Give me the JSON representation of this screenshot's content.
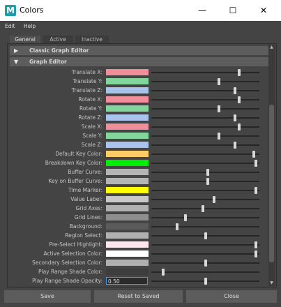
{
  "window": {
    "title": "Colors",
    "app_icon_letter": "M",
    "minimize": "—",
    "maximize": "☐",
    "close": "✕"
  },
  "menu": [
    "Edit",
    "Help"
  ],
  "tabs": [
    "General",
    "Active",
    "Inactive"
  ],
  "sections": {
    "classic": "Classic Graph Editor",
    "graph": "Graph Editor",
    "classic_icon": "collapsed-triangle-icon",
    "graph_icon": "expanded-triangle-icon"
  },
  "rows": [
    {
      "label": "Translate X:",
      "color": "#f08e9b",
      "level": 0.82
    },
    {
      "label": "Translate Y:",
      "color": "#82d69c",
      "level": 0.63
    },
    {
      "label": "Translate Z:",
      "color": "#a9c4ec",
      "level": 0.78
    },
    {
      "label": "Rotate X:",
      "color": "#f08e9b",
      "level": 0.82
    },
    {
      "label": "Rotate Y:",
      "color": "#82d69c",
      "level": 0.63
    },
    {
      "label": "Rotate Z:",
      "color": "#a9c4ec",
      "level": 0.78
    },
    {
      "label": "Scale X:",
      "color": "#f08e9b",
      "level": 0.82
    },
    {
      "label": "Scale Y:",
      "color": "#82d69c",
      "level": 0.63
    },
    {
      "label": "Scale Z:",
      "color": "#a9c4ec",
      "level": 0.78
    },
    {
      "label": "Default Key Color:",
      "color": "#ffcc66",
      "level": 0.96
    },
    {
      "label": "Breakdown Key Color:",
      "color": "#00ee00",
      "level": 0.98
    },
    {
      "label": "Buffer Curve:",
      "color": "#b5b5b5",
      "level": 0.52
    },
    {
      "label": "Key on Buffer Curve:",
      "color": "#b5b5b5",
      "level": 0.52
    },
    {
      "label": "Time Marker:",
      "color": "#ffff00",
      "level": 0.98
    },
    {
      "label": "Value Label:",
      "color": "#c8c8c8",
      "level": 0.58
    },
    {
      "label": "Grid Axes:",
      "color": "#b0b0b0",
      "level": 0.48
    },
    {
      "label": "Grid Lines:",
      "color": "#8e8e8e",
      "level": 0.31
    },
    {
      "label": "Background:",
      "color": "#5b5b5b",
      "level": 0.23
    },
    {
      "label": "Region Select:",
      "color": "#b0b0b0",
      "level": 0.5
    },
    {
      "label": "Pre-Select Highlight:",
      "color": "#ffe6f0",
      "level": 0.98
    },
    {
      "label": "Active Selection Color:",
      "color": "#ffffff",
      "level": 0.98
    },
    {
      "label": "Secondary Selection Color:",
      "color": "#b0b0b0",
      "level": 0.5
    },
    {
      "label": "Play Range Shade Color:",
      "color": "#3d3d3d",
      "level": 0.1
    }
  ],
  "opacity_row": {
    "label": "Play Range Shade Opacity:",
    "value": "0.50",
    "level": 0.5
  },
  "buttons": {
    "save": "Save",
    "reset": "Reset to Saved",
    "close": "Close"
  }
}
